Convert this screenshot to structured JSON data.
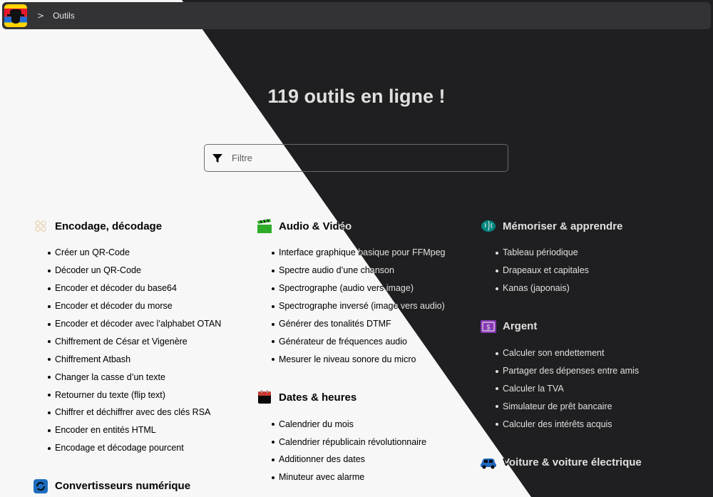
{
  "breadcrumb": {
    "separator": ">",
    "current": "Outils"
  },
  "title": "119 outils en ligne !",
  "filter": {
    "placeholder": "Filtre"
  },
  "columns": [
    [
      {
        "title": "Encodage, décodage",
        "icon": "dots-grid-icon",
        "items": [
          "Créer un QR-Code",
          "Décoder un QR-Code",
          "Encoder et décoder du base64",
          "Encoder et décoder du morse",
          "Encoder et décoder avec l’alphabet OTAN",
          "Chiffrement de César et Vigenère",
          "Chiffrement Atbash",
          "Changer la casse d’un texte",
          "Retourner du texte (flip text)",
          "Chiffrer et déchiffrer avec des clés RSA",
          "Encoder en entités HTML",
          "Encodage et décodage pourcent"
        ]
      },
      {
        "title": "Convertisseurs numérique",
        "icon": "refresh-icon",
        "items": []
      }
    ],
    [
      {
        "title": "Audio & Vidéo",
        "icon": "clapper-icon",
        "items": [
          "Interface graphique basique pour FFMpeg",
          "Spectre audio d’une chanson",
          "Spectrographe (audio vers image)",
          "Spectrographe inversé (image vers audio)",
          "Générer des tonalités DTMF",
          "Générateur de fréquences audio",
          "Mesurer le niveau sonore du micro"
        ]
      },
      {
        "title": "Dates & heures",
        "icon": "calendar-icon",
        "items": [
          "Calendrier du mois",
          "Calendrier républicain révolutionnaire",
          "Additionner des dates",
          "Minuteur avec alarme"
        ]
      }
    ],
    [
      {
        "title": "Mémoriser & apprendre",
        "icon": "brain-icon",
        "items": [
          "Tableau périodique",
          "Drapeaux et capitales",
          "Kanas (japonais)"
        ]
      },
      {
        "title": "Argent",
        "icon": "banknote-icon",
        "items": [
          "Calculer son endettement",
          "Partager des dépenses entre amis",
          "Calculer la TVA",
          "Simulateur de prêt bancaire",
          "Calculer des intérêts acquis"
        ]
      },
      {
        "title": "Voiture & voiture électrique",
        "icon": "car-icon",
        "items": []
      }
    ]
  ]
}
